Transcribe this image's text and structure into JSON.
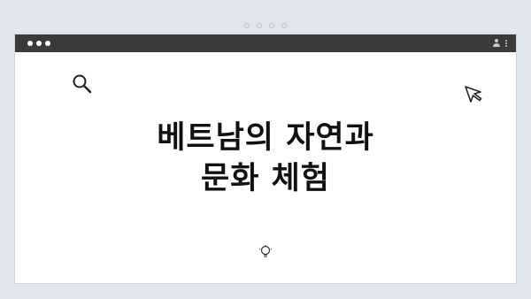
{
  "hero": {
    "title_line1": "베트남의 자연과",
    "title_line2": "문화 체험"
  },
  "icons": {
    "search": "search-icon",
    "cursor": "cursor-icon",
    "bulb": "lightbulb-icon",
    "user": "user-icon",
    "menu": "kebab-menu-icon"
  },
  "colors": {
    "page_background": "#e1e5ec",
    "titlebar": "#3b3b3b",
    "content_background": "#ffffff",
    "title_text": "#111111"
  }
}
